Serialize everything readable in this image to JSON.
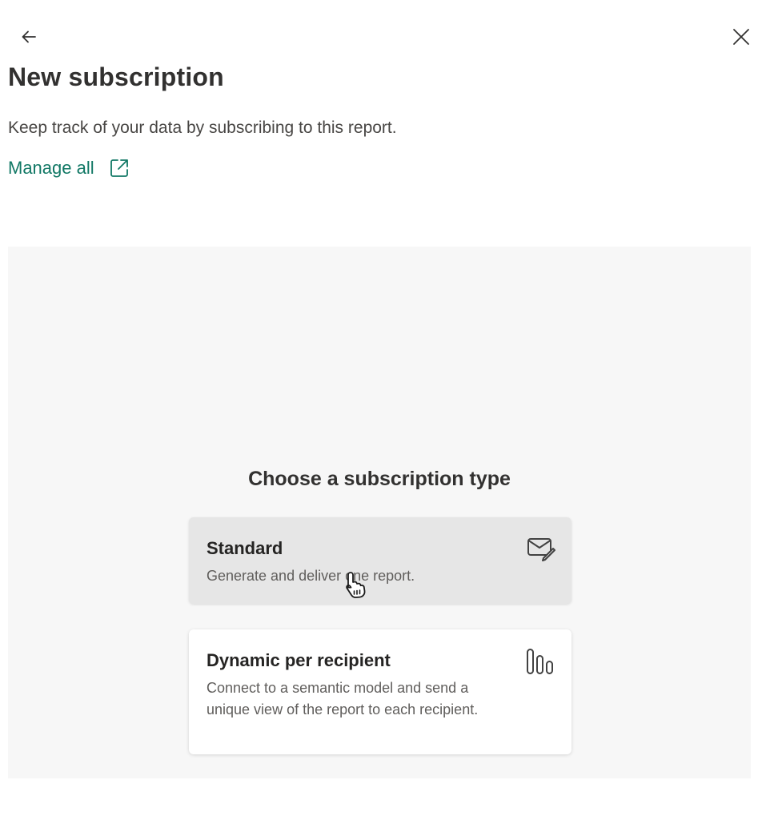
{
  "header": {
    "back_icon": "arrow-left-icon",
    "close_icon": "close-icon",
    "title": "New subscription",
    "description": "Keep track of your data by subscribing to this report.",
    "manage_all_label": "Manage all",
    "manage_all_icon": "open-external-icon"
  },
  "panel": {
    "heading": "Choose a subscription type",
    "options": [
      {
        "title": "Standard",
        "description": "Generate and deliver one report.",
        "icon": "mail-edit-icon",
        "state": "hovered"
      },
      {
        "title": "Dynamic per recipient",
        "description": "Connect to a semantic model and send a unique view of the report to each recipient.",
        "icon": "bar-chart-icon"
      }
    ]
  },
  "colors": {
    "accent_link": "#117865",
    "panel_background": "#f7f7f7",
    "hover_card": "#e6e6e6"
  }
}
